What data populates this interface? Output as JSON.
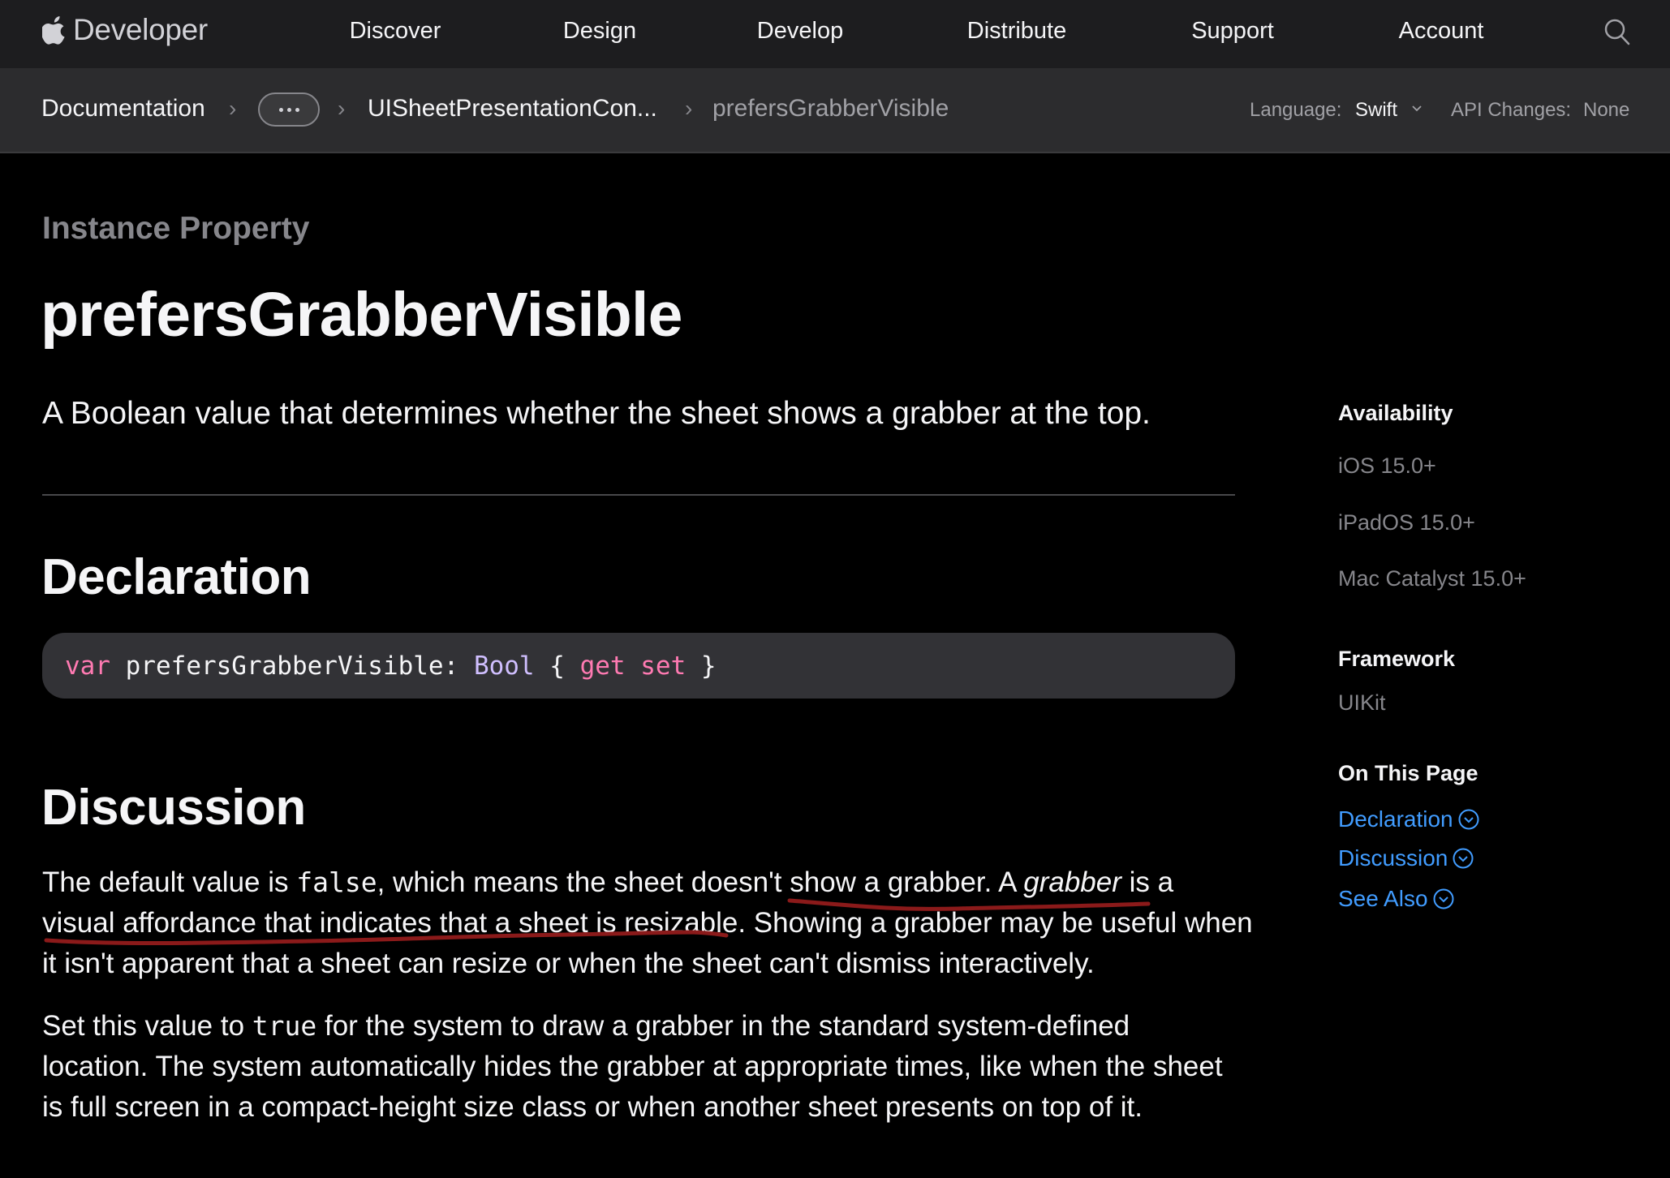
{
  "globalnav": {
    "brand": "Developer",
    "items": [
      "Discover",
      "Design",
      "Develop",
      "Distribute",
      "Support",
      "Account"
    ],
    "search_icon": "search-icon"
  },
  "docnav": {
    "crumbs": [
      "Documentation",
      "UISheetPresentationCon...",
      "prefersGrabberVisible"
    ],
    "more_icon": "ellipsis-icon",
    "language_label": "Language:",
    "language_value": "Swift",
    "api_changes_label": "API Changes:",
    "api_changes_value": "None"
  },
  "main": {
    "eyebrow": "Instance Property",
    "title": "prefersGrabberVisible",
    "abstract": "A Boolean value that determines whether the sheet shows a grabber at the top.",
    "declaration_heading": "Declaration",
    "code": {
      "kw": "var",
      "name": " prefersGrabberVisible: ",
      "type": "Bool",
      "open": " { ",
      "get": "get",
      "space": " ",
      "set": "set",
      "close": " }"
    },
    "discussion_heading": "Discussion",
    "para1": {
      "l1a": "The default value is ",
      "l1code": "false",
      "l1b": ", which means the sheet doesn't show a grabber. A ",
      "l1em": "grabber",
      "l1c": " is a",
      "l2": "visual affordance that indicates that a sheet is resizable. Showing a grabber may be useful when",
      "l3": "it isn't apparent that a sheet can resize or when the sheet can't dismiss interactively."
    },
    "para2": {
      "l1a": "Set this value to ",
      "l1code": "true",
      "l1b": " for the system to draw a grabber in the standard system-defined",
      "l2": "location. The system automatically hides the grabber at appropriate times, like when the sheet",
      "l3": "is full screen in a compact-height size class or when another sheet presents on top of it."
    },
    "annotation_color": "#8b1a1a"
  },
  "sidebar": {
    "availability_heading": "Availability",
    "availability": [
      "iOS 15.0+",
      "iPadOS 15.0+",
      "Mac Catalyst 15.0+"
    ],
    "framework_heading": "Framework",
    "framework": "UIKit",
    "on_this_page_heading": "On This Page",
    "links": [
      "Declaration",
      "Discussion",
      "See Also"
    ]
  },
  "colors": {
    "accent_link": "#419cff",
    "code_keyword": "#ff7ab2",
    "code_type": "#d0bfff"
  }
}
